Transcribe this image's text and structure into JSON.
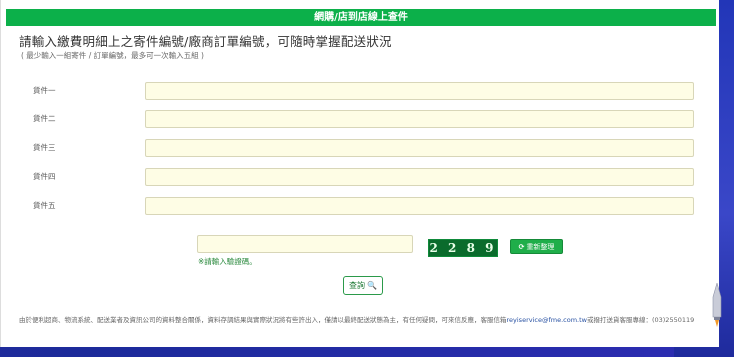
{
  "header": {
    "title": "網購/店到店線上查件"
  },
  "form": {
    "title": "請輸入繳費明細上之寄件編號/廠商訂單編號，可隨時掌握配送狀況",
    "subtitle": "( 最少輸入一組寄件 / 訂單編號，最多可一次輸入五組 )",
    "rows": [
      {
        "label": "貨件一",
        "value": ""
      },
      {
        "label": "貨件二",
        "value": ""
      },
      {
        "label": "貨件三",
        "value": ""
      },
      {
        "label": "貨件四",
        "value": ""
      },
      {
        "label": "貨件五",
        "value": ""
      }
    ]
  },
  "captcha": {
    "value": "",
    "hint": "※請輸入驗證碼。",
    "image_text": "2 2 8 9 2",
    "refresh_label": "重新整理",
    "refresh_icon": "refresh-icon"
  },
  "search": {
    "label": "查詢",
    "icon": "magnifier-icon"
  },
  "footer": {
    "text_before": "由於便利超商、物流系統、配送業者及資訊公司的資料整合關係，資料存調結果與實際狀況將有些許出入，僅請以最終配送狀態為主，有任何疑問，可來信反應，客服信箱",
    "email": "reyiservice@fme.com.tw",
    "text_after": "或撥打送貨客服專線：(03)2550119"
  },
  "colors": {
    "header_green": "#0cb04a",
    "input_bg": "#fefde5",
    "link_blue": "#2952a3"
  }
}
